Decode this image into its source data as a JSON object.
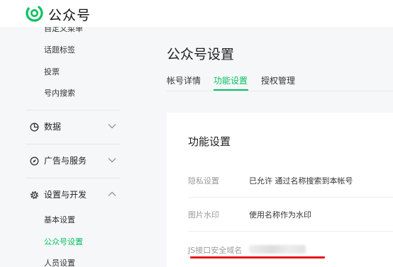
{
  "header": {
    "app_name": "公众号"
  },
  "sidebar": {
    "cut_item": "自定义菜单",
    "sub_items_top": [
      "话题标签",
      "投票",
      "号内搜索"
    ],
    "groups": [
      {
        "label": "数据",
        "icon": "pie-chart-icon",
        "expanded": false
      },
      {
        "label": "广告与服务",
        "icon": "compass-icon",
        "expanded": false
      },
      {
        "label": "设置与开发",
        "icon": "gear-icon",
        "expanded": true
      }
    ],
    "sub_items_settings": [
      "基本设置",
      "公众号设置",
      "人员设置"
    ],
    "active_item": "公众号设置"
  },
  "main": {
    "title": "公众号设置",
    "tabs": [
      "帐号详情",
      "功能设置",
      "授权管理"
    ],
    "active_tab": "功能设置",
    "card_title": "功能设置",
    "rows": [
      {
        "label": "隐私设置",
        "value": "已允许 通过名称搜索到本帐号"
      },
      {
        "label": "图片水印",
        "value": "使用名称作为水印"
      },
      {
        "label": "JS接口安全域名",
        "value": ""
      }
    ]
  },
  "colors": {
    "accent": "#07c160",
    "annotation": "#e8121a"
  }
}
